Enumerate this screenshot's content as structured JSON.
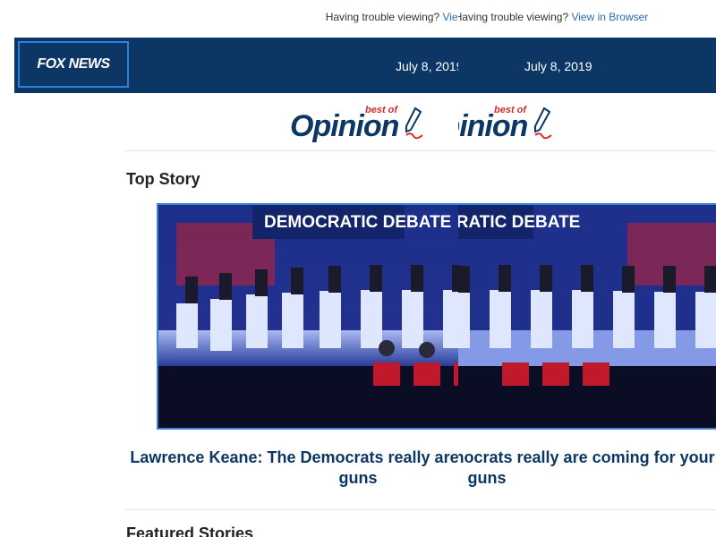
{
  "preheader": {
    "text": "Having trouble viewing?",
    "link": "View in Browser"
  },
  "header": {
    "logo": "FOX NEWS",
    "date": "July 8, 2019"
  },
  "banner": {
    "best_of": "best of",
    "opinion": "Opinion"
  },
  "top_story": {
    "section_title": "Top Story",
    "image_caption": "DEMOCRATIC DEBATE",
    "headline": "Lawrence Keane: The Democrats really are coming for your guns"
  },
  "featured": {
    "section_title": "Featured Stories"
  },
  "colors": {
    "navy": "#0c3765",
    "link": "#2b6cb0",
    "accent_red": "#d92b2b",
    "frame_blue": "#3b7fd6"
  }
}
